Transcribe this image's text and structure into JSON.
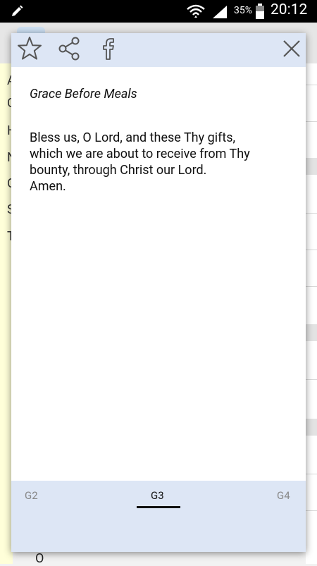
{
  "status_bar": {
    "battery_percent": "35%",
    "time": "20:12",
    "icons": [
      "pencil-icon",
      "wifi-icon",
      "signal-icon",
      "battery-icon"
    ]
  },
  "background": {
    "letters": [
      "A",
      "C",
      "H",
      "N",
      "O",
      "S",
      "T"
    ],
    "bottom_text": "O"
  },
  "toolbar": {
    "icons": [
      "star-icon",
      "share-icon",
      "facebook-icon",
      "close-icon"
    ]
  },
  "prayer": {
    "title": "Grace Before Meals",
    "body": "Bless us, O Lord, and these Thy gifts,\nwhich we are about to receive from Thy\nbounty, through Christ our Lord.\nAmen."
  },
  "tabs": [
    {
      "label": "G2",
      "active": false
    },
    {
      "label": "G3",
      "active": true
    },
    {
      "label": "G4",
      "active": false
    }
  ],
  "colors": {
    "toolbar_bg": "#dde6f5",
    "tabbar_bg": "#dde6f5",
    "left_strip": "#ffffd9"
  }
}
